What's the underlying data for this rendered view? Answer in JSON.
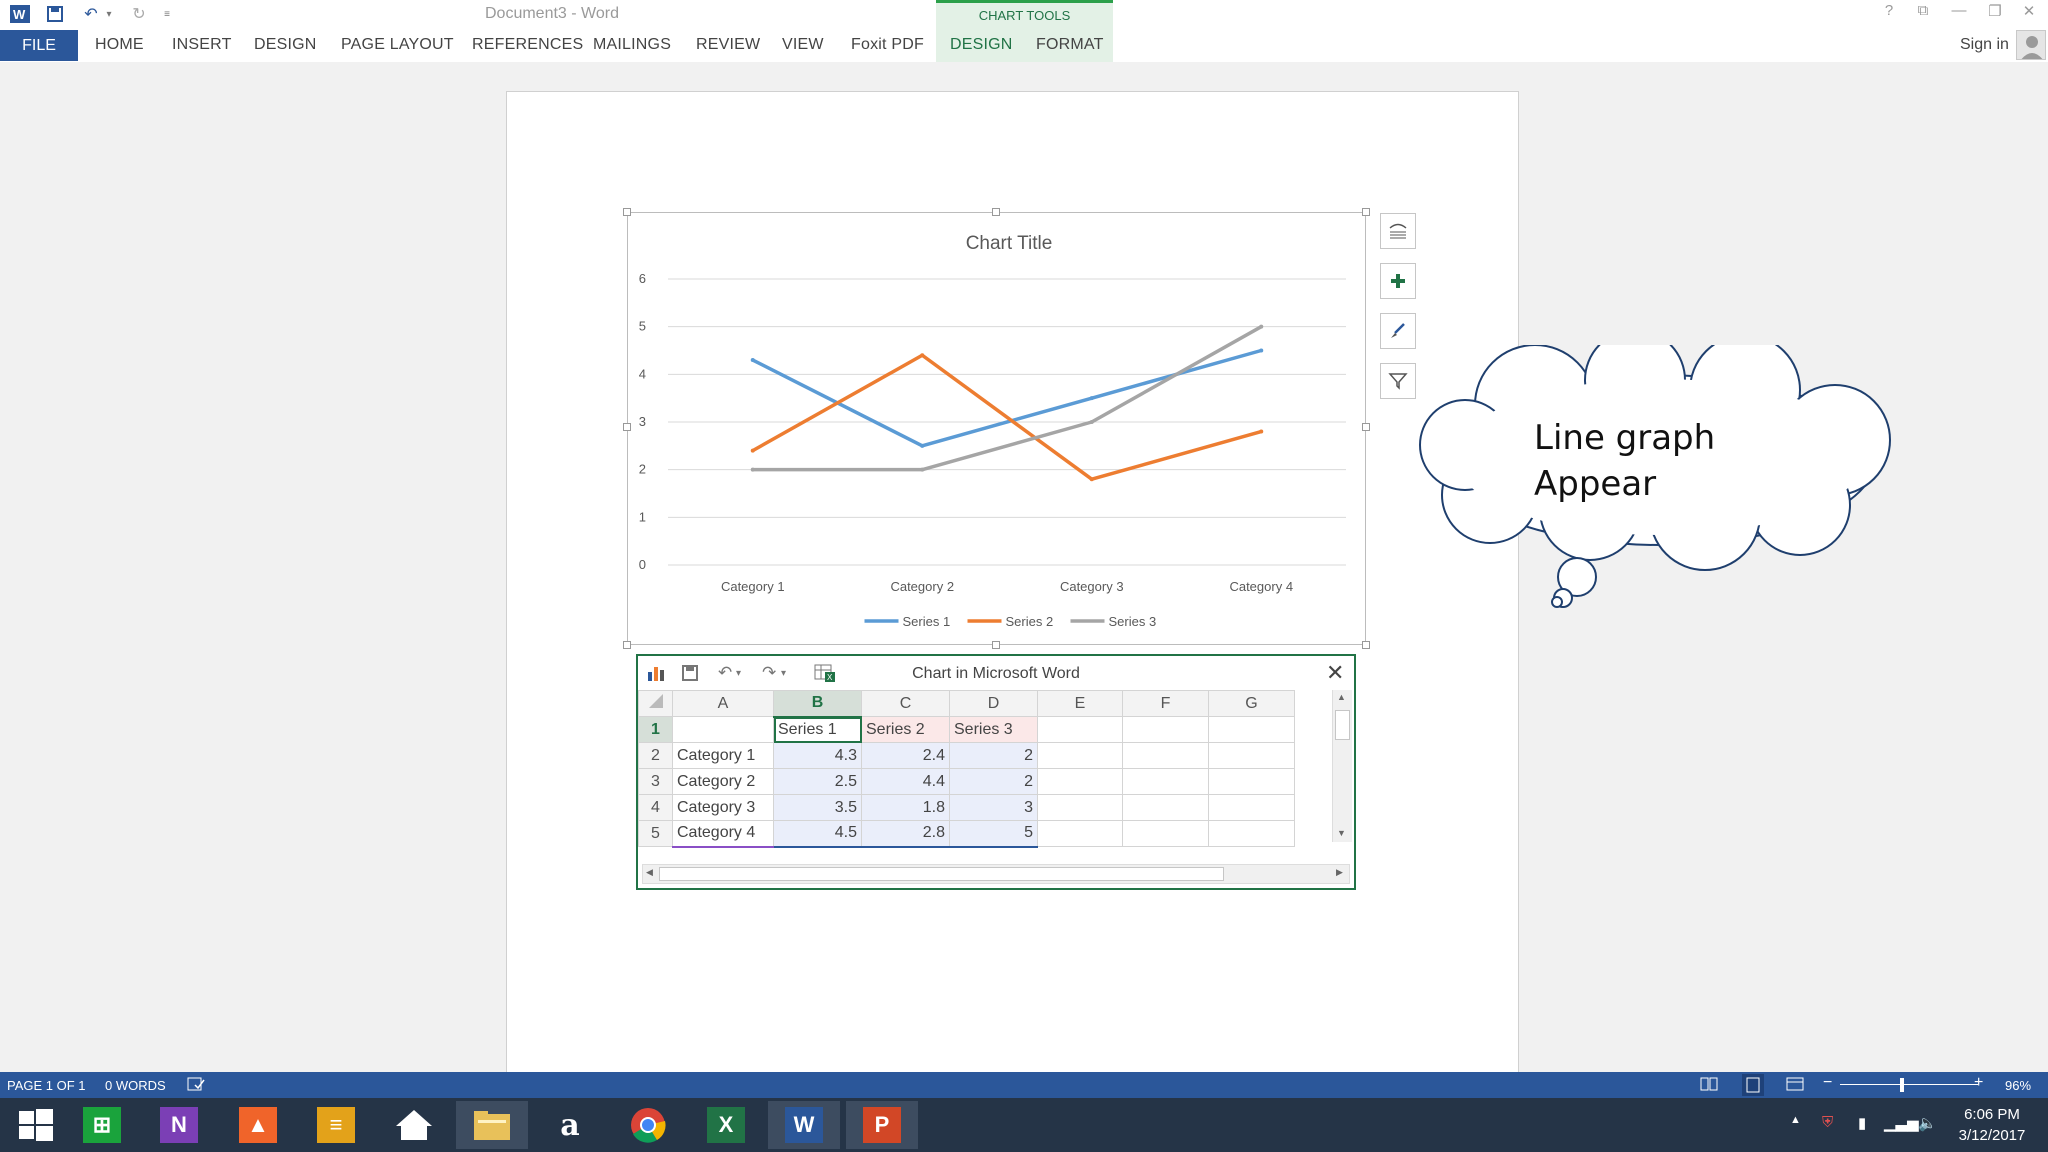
{
  "app": {
    "document_title": "Document3 - Word",
    "quick_access": [
      "word-icon",
      "save-icon",
      "undo-icon",
      "redo-icon",
      "customize-icon"
    ]
  },
  "ribbon": {
    "file_tab": "FILE",
    "tabs": [
      "HOME",
      "INSERT",
      "DESIGN",
      "PAGE LAYOUT",
      "REFERENCES",
      "MAILINGS",
      "REVIEW",
      "VIEW",
      "Foxit PDF"
    ],
    "context_group": "CHART TOOLS",
    "context_tabs": [
      "DESIGN",
      "FORMAT"
    ],
    "sign_in": "Sign in"
  },
  "chart_data": {
    "type": "line",
    "title": "Chart Title",
    "categories": [
      "Category 1",
      "Category 2",
      "Category 3",
      "Category 4"
    ],
    "series": [
      {
        "name": "Series 1",
        "values": [
          4.3,
          2.5,
          3.5,
          4.5
        ],
        "color": "#5b9bd5"
      },
      {
        "name": "Series 2",
        "values": [
          2.4,
          4.4,
          1.8,
          2.8
        ],
        "color": "#ed7d31"
      },
      {
        "name": "Series 3",
        "values": [
          2,
          2,
          3,
          5
        ],
        "color": "#a5a5a5"
      }
    ],
    "ylim": [
      0,
      6
    ],
    "yticks": [
      "0",
      "1",
      "2",
      "3",
      "4",
      "5",
      "6"
    ],
    "grid": true,
    "legend": "bottom"
  },
  "chart_side_buttons": [
    "layout-options-icon",
    "chart-elements-plus-icon",
    "chart-styles-brush-icon",
    "chart-filters-funnel-icon"
  ],
  "spreadsheet": {
    "title": "Chart in Microsoft Word",
    "columns": [
      "A",
      "B",
      "C",
      "D",
      "E",
      "F",
      "G"
    ],
    "rows": [
      {
        "num": "1",
        "cells": [
          "",
          "Series 1",
          "Series 2",
          "Series 3",
          "",
          "",
          ""
        ]
      },
      {
        "num": "2",
        "cells": [
          "Category 1",
          "4.3",
          "2.4",
          "2",
          "",
          "",
          ""
        ]
      },
      {
        "num": "3",
        "cells": [
          "Category 2",
          "2.5",
          "4.4",
          "2",
          "",
          "",
          ""
        ]
      },
      {
        "num": "4",
        "cells": [
          "Category 3",
          "3.5",
          "1.8",
          "3",
          "",
          "",
          ""
        ]
      },
      {
        "num": "5",
        "cells": [
          "Category 4",
          "4.5",
          "2.8",
          "5",
          "",
          "",
          ""
        ]
      }
    ]
  },
  "callout": {
    "line1": "Line graph",
    "line2": "Appear"
  },
  "status": {
    "page": "PAGE 1 OF 1",
    "words": "0 WORDS",
    "zoom": "96%"
  },
  "taskbar": {
    "time": "6:06 PM",
    "date": "3/12/2017",
    "apps": [
      "windows-start-icon",
      "store-icon",
      "onenote-icon",
      "photos-icon",
      "notes-icon",
      "home-icon",
      "file-explorer-icon",
      "amazon-icon",
      "chrome-icon",
      "excel-icon",
      "word-icon",
      "powerpoint-icon"
    ]
  }
}
